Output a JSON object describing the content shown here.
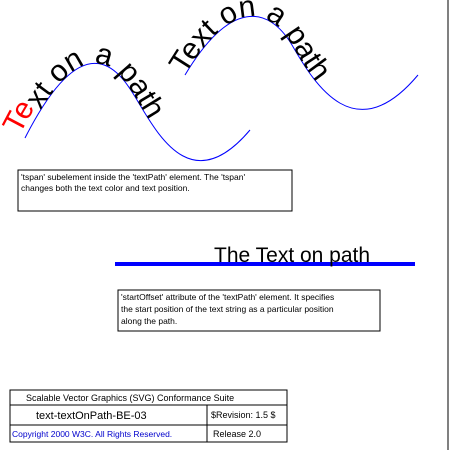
{
  "curve1": {
    "text": "Text on a path",
    "tspan_text": "Te",
    "rest_text": "xt on a path",
    "tspan_color": "#ff0000",
    "text_color": "#000000",
    "path_color": "#0000ff"
  },
  "curve2": {
    "text": "Text on a path",
    "text_color": "#000000",
    "path_color": "#0000ff"
  },
  "note1": {
    "lines": [
      "'tspan' subelement inside the 'textPath' element. The 'tspan'",
      "changes both the text color and text position."
    ]
  },
  "line3": {
    "text": "The Text on path",
    "line_color": "#0000ff"
  },
  "note2": {
    "lines": [
      "'startOffset' attribute of the 'textPath' element. It specifies",
      "the start position of the text string as a particular position",
      "along the path."
    ]
  },
  "footer": {
    "suite_title": "Scalable Vector Graphics (SVG) Conformance Suite",
    "test_name": "text-textOnPath-BE-03",
    "revision": "$Revision: 1.5 $",
    "copyright": "Copyright 2000 W3C. All Rights Reserved.",
    "release": "Release 2.0",
    "copyright_color": "#0000cc"
  }
}
